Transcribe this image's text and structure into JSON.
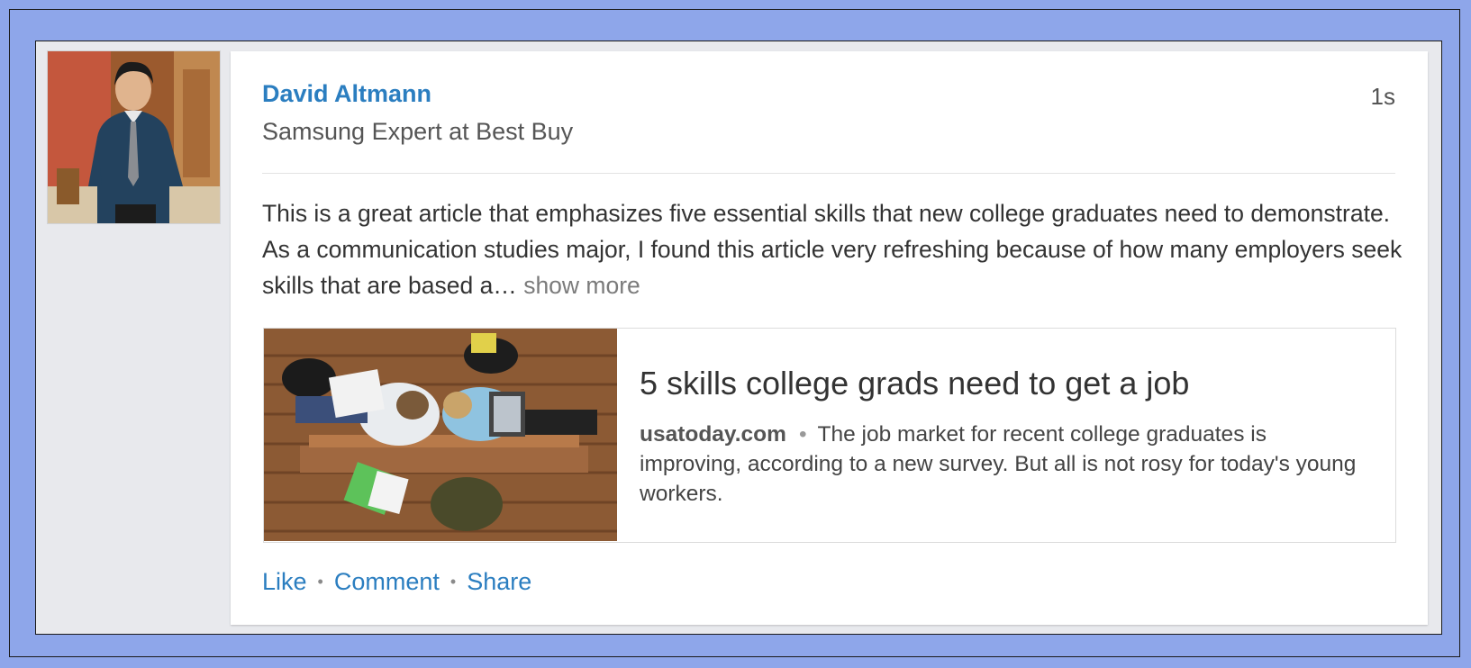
{
  "post": {
    "author": {
      "name": "David Altmann",
      "headline": "Samsung Expert at Best Buy",
      "avatar_icon": "profile-photo"
    },
    "timestamp": "1s",
    "more_icon": "ellipsis-icon",
    "body_text": "This is a great article that emphasizes five essential skills that new college graduates need to demonstrate. As a communication studies major, I found this article very refreshing because of how many employers seek skills that are based a…",
    "show_more_label": "show more",
    "link_preview": {
      "title": "5 skills college grads need to get a job",
      "domain": "usatoday.com",
      "separator": "•",
      "description": "The job market for recent college graduates is improving, according to a new survey. But all is not rosy for today's young workers."
    },
    "actions": {
      "like_label": "Like",
      "comment_label": "Comment",
      "share_label": "Share",
      "separator": "•"
    }
  },
  "colors": {
    "background": "#8ea6ea",
    "feed_background": "#e8e9ed",
    "link_blue": "#2b7ec0",
    "text_dark": "#333333",
    "text_muted": "#555555"
  }
}
